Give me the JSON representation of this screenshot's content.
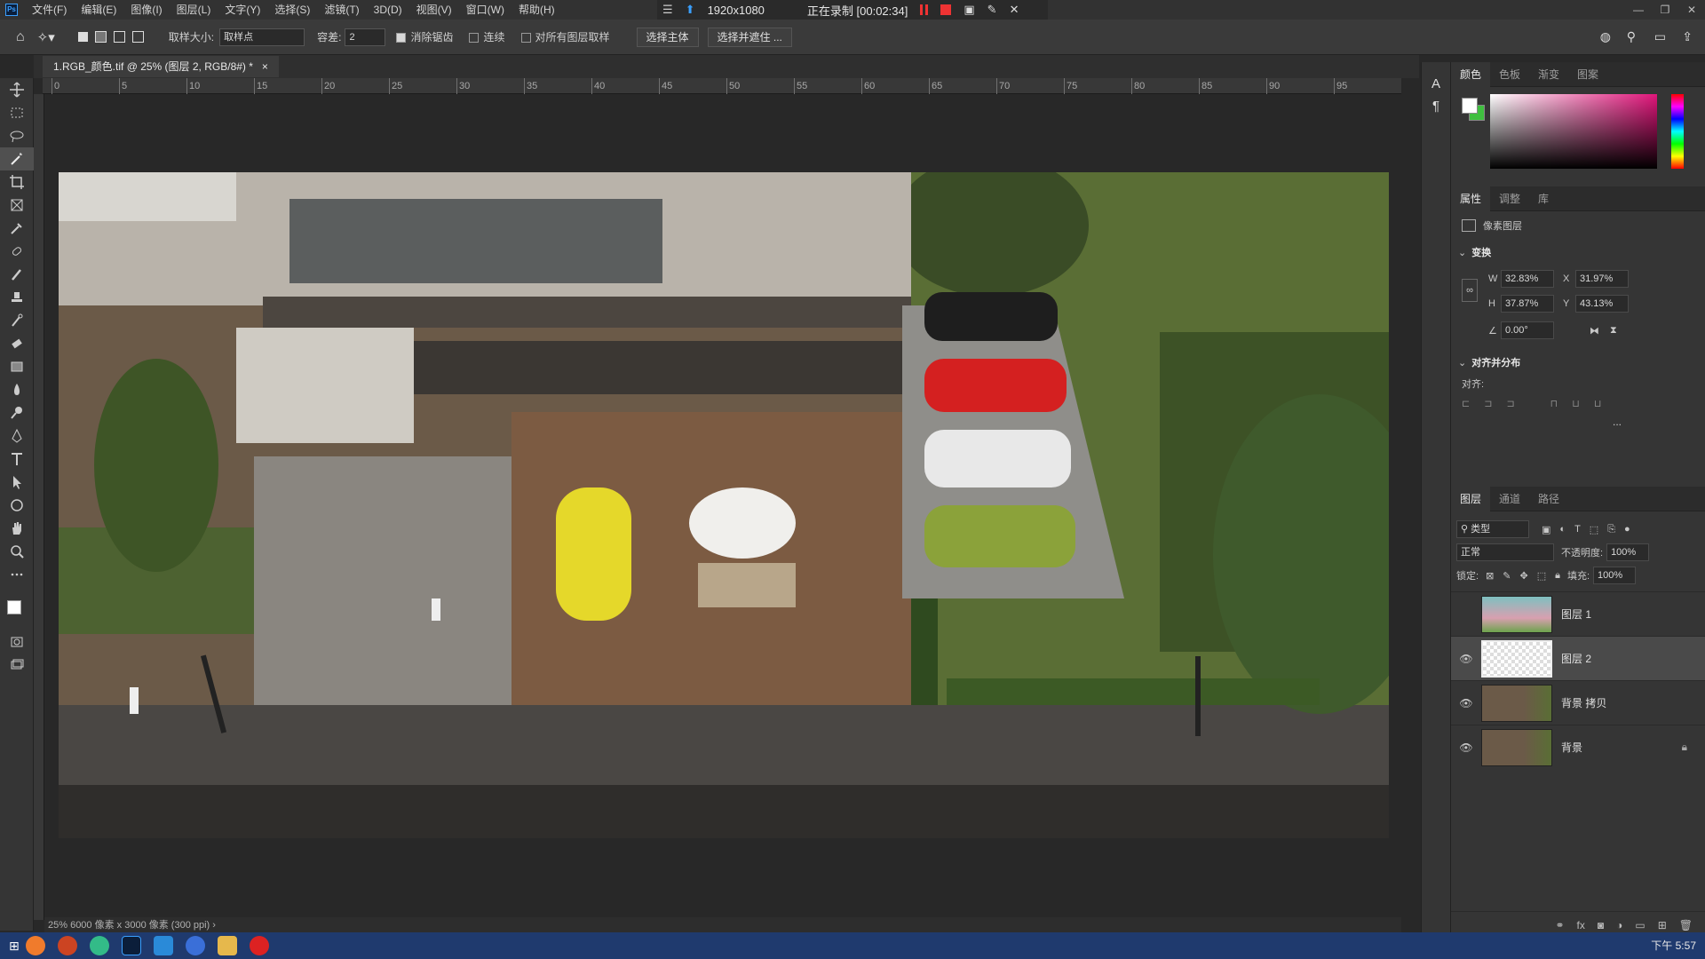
{
  "menubar": {
    "items": [
      "文件(F)",
      "编辑(E)",
      "图像(I)",
      "图层(L)",
      "文字(Y)",
      "选择(S)",
      "滤镜(T)",
      "3D(D)",
      "视图(V)",
      "窗口(W)",
      "帮助(H)"
    ],
    "logo": "Ps"
  },
  "recorder": {
    "resolution": "1920x1080",
    "status": "正在录制 [00:02:34]"
  },
  "options": {
    "sample_size_label": "取样大小:",
    "sample_size_value": "取样点",
    "tolerance_label": "容差:",
    "tolerance_value": "2",
    "antialias_label": "消除锯齿",
    "contiguous_label": "连续",
    "sample_all_label": "对所有图层取样",
    "select_subject": "选择主体",
    "select_mask": "选择并遮住 ..."
  },
  "document": {
    "tab_title": "1.RGB_颜色.tif @ 25% (图层 2, RGB/8#) *",
    "tab_close": "×"
  },
  "ruler": {
    "labels": [
      "0",
      "5",
      "10",
      "15",
      "20",
      "25",
      "30",
      "35",
      "40",
      "45",
      "50",
      "55",
      "60",
      "65",
      "70",
      "75",
      "80",
      "85",
      "90",
      "95"
    ]
  },
  "status": {
    "text": "25%    6000 像素 x 3000 像素 (300 ppi)   ›"
  },
  "color_panel": {
    "tabs": [
      "颜色",
      "色板",
      "渐变",
      "图案"
    ]
  },
  "properties_panel": {
    "tabs": [
      "属性",
      "调整",
      "库"
    ],
    "layer_type": "像素图层",
    "transform_title": "变换",
    "w_label": "W",
    "w_value": "32.83%",
    "x_label": "X",
    "x_value": "31.97%",
    "h_label": "H",
    "h_value": "37.87%",
    "y_label": "Y",
    "y_value": "43.13%",
    "angle_value": "0.00°",
    "align_title": "对齐并分布",
    "align_label": "对齐:",
    "more": "..."
  },
  "layers_panel": {
    "tabs": [
      "图层",
      "通道",
      "路径"
    ],
    "filter_value": "类型",
    "blend_mode": "正常",
    "opacity_label": "不透明度:",
    "opacity_value": "100%",
    "lock_label": "锁定:",
    "fill_label": "填充:",
    "fill_value": "100%",
    "layers": [
      {
        "name": "图层 1",
        "visible": false,
        "selected": false
      },
      {
        "name": "图层 2",
        "visible": true,
        "selected": true
      },
      {
        "name": "背景 拷贝",
        "visible": true,
        "selected": false
      },
      {
        "name": "背景",
        "visible": true,
        "selected": false,
        "locked": true
      }
    ]
  },
  "taskbar": {
    "clock": "下午 5:57"
  },
  "colors": {
    "accent": "#3aa0ff",
    "foreground_swatch": "#ffffff",
    "background_swatch": "#3fbf3f",
    "picker_hue": "#e0157a"
  }
}
